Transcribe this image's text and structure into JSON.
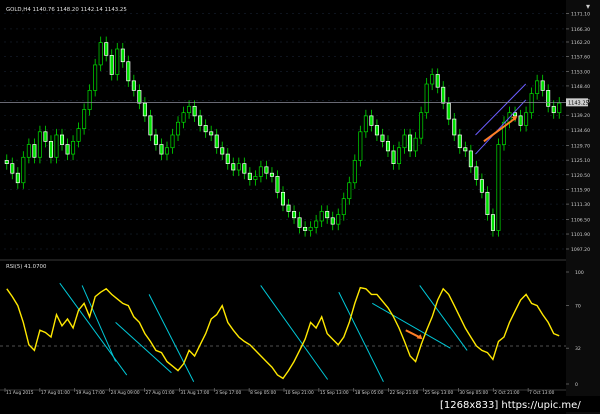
{
  "chart_data": [
    {
      "type": "candlestick",
      "title": "GOLD,H4  1140.76  1148.20  1142.14  1143.25",
      "price_labels": [
        "1171.10",
        "1166.30",
        "1162.20",
        "1157.60",
        "1153.00",
        "1148.40",
        "1143.80",
        "1139.20",
        "1134.60",
        "1129.70",
        "1125.10",
        "1120.50",
        "1115.90",
        "1111.30",
        "1106.50",
        "1101.90",
        "1097.20"
      ],
      "current_price": "1143.25",
      "ylim": [
        1095.0,
        1173.5
      ],
      "price_series": [
        1124.0,
        1121.0,
        1118.0,
        1126.0,
        1130.0,
        1126.0,
        1134.0,
        1131.0,
        1126.0,
        1133.0,
        1130.0,
        1127.0,
        1131.0,
        1135.0,
        1141.0,
        1147.0,
        1155.0,
        1162.0,
        1158.0,
        1152.0,
        1160.0,
        1156.0,
        1150.0,
        1147.0,
        1143.0,
        1139.0,
        1133.0,
        1130.0,
        1127.0,
        1129.0,
        1133.0,
        1137.0,
        1140.0,
        1142.0,
        1139.0,
        1136.0,
        1134.0,
        1133.0,
        1129.0,
        1127.0,
        1124.0,
        1122.0,
        1124.0,
        1121.0,
        1119.0,
        1120.0,
        1123.0,
        1121.0,
        1120.0,
        1115.0,
        1111.0,
        1109.0,
        1107.0,
        1104.0,
        1103.0,
        1104.0,
        1106.0,
        1109.0,
        1107.0,
        1105.0,
        1108.0,
        1113.0,
        1118.0,
        1125.0,
        1134.0,
        1139.0,
        1136.0,
        1133.0,
        1131.0,
        1128.0,
        1124.0,
        1129.0,
        1133.0,
        1128.0,
        1132.0,
        1140.0,
        1149.0,
        1152.0,
        1148.0,
        1143.0,
        1138.0,
        1133.0,
        1129.0,
        1128.0,
        1123.0,
        1119.0,
        1115.0,
        1108.0,
        1103.0,
        1130.0,
        1137.0,
        1140.0,
        1139.0,
        1136.0,
        1140.0,
        1146.0,
        1150.0,
        1147.0,
        1142.0,
        1140.0,
        1143.0
      ],
      "price_high_offset": 1.9,
      "price_low_offset": 1.9,
      "channel": [
        [
          1133.0,
          1149.0
        ],
        [
          1127.0,
          1144.0
        ]
      ],
      "channel_span": [
        0.845,
        0.935
      ],
      "arrow_span": [
        0.86,
        0.92
      ],
      "arrow_price": [
        1131.0,
        1139.0
      ]
    },
    {
      "type": "line",
      "title": "RSI(5) 41.0700",
      "axis_labels": [
        "100",
        "70",
        "32",
        "0"
      ],
      "level_label": "32",
      "ylim": [
        0,
        100
      ],
      "rsi_series": [
        85,
        78,
        70,
        55,
        35,
        30,
        48,
        46,
        42,
        62,
        52,
        58,
        50,
        66,
        72,
        60,
        78,
        82,
        85,
        80,
        76,
        72,
        70,
        60,
        55,
        45,
        38,
        30,
        28,
        20,
        16,
        12,
        18,
        30,
        25,
        35,
        45,
        58,
        62,
        70,
        55,
        48,
        42,
        38,
        35,
        30,
        25,
        20,
        15,
        8,
        5,
        12,
        20,
        30,
        40,
        55,
        50,
        60,
        45,
        40,
        35,
        42,
        55,
        72,
        86,
        85,
        80,
        80,
        74,
        68,
        60,
        50,
        38,
        25,
        20,
        35,
        48,
        60,
        75,
        85,
        80,
        70,
        60,
        50,
        42,
        34,
        30,
        28,
        22,
        38,
        42,
        55,
        65,
        75,
        80,
        72,
        70,
        62,
        55,
        45,
        43
      ],
      "trendlines": [
        {
          "from": [
            0.1,
            90
          ],
          "to": [
            0.22,
            8
          ]
        },
        {
          "from": [
            0.14,
            88
          ],
          "to": [
            0.2,
            20
          ]
        },
        {
          "from": [
            0.2,
            55
          ],
          "to": [
            0.3,
            10
          ]
        },
        {
          "from": [
            0.26,
            80
          ],
          "to": [
            0.34,
            2
          ]
        },
        {
          "from": [
            0.46,
            88
          ],
          "to": [
            0.58,
            4
          ]
        },
        {
          "from": [
            0.6,
            82
          ],
          "to": [
            0.68,
            2
          ]
        },
        {
          "from": [
            0.66,
            72
          ],
          "to": [
            0.8,
            32
          ]
        },
        {
          "from": [
            0.745,
            88
          ],
          "to": [
            0.83,
            30
          ]
        }
      ],
      "arrow_span": [
        0.72,
        0.75
      ],
      "arrow_rsi": [
        48,
        40
      ]
    }
  ],
  "time_labels": [
    "11 Aug 2015",
    "17 Aug 01:00",
    "19 Aug 17:00",
    "24 Aug 09:00",
    "27 Aug 01:00",
    "31 Aug 17:00",
    "3 Sep 17:00",
    "8 Sep 05:00",
    "10 Sep 21:00",
    "15 Sep 13:00",
    "18 Sep 05:00",
    "22 Sep 21:00",
    "25 Sep 13:00",
    "30 Sep 05:00",
    "2 Oct 21:00",
    "7 Oct 13:00"
  ],
  "watermark": "[1268x833] https://upic.me/",
  "colors": {
    "bull": "#00e000",
    "bear": "#ffffff",
    "rsi": "#ffe800",
    "channel": "#6b5cff",
    "trendline": "#00c8d7",
    "arrow": "#ff7f27",
    "grid": "#1e2a3c",
    "hline": "#8c8c99"
  }
}
